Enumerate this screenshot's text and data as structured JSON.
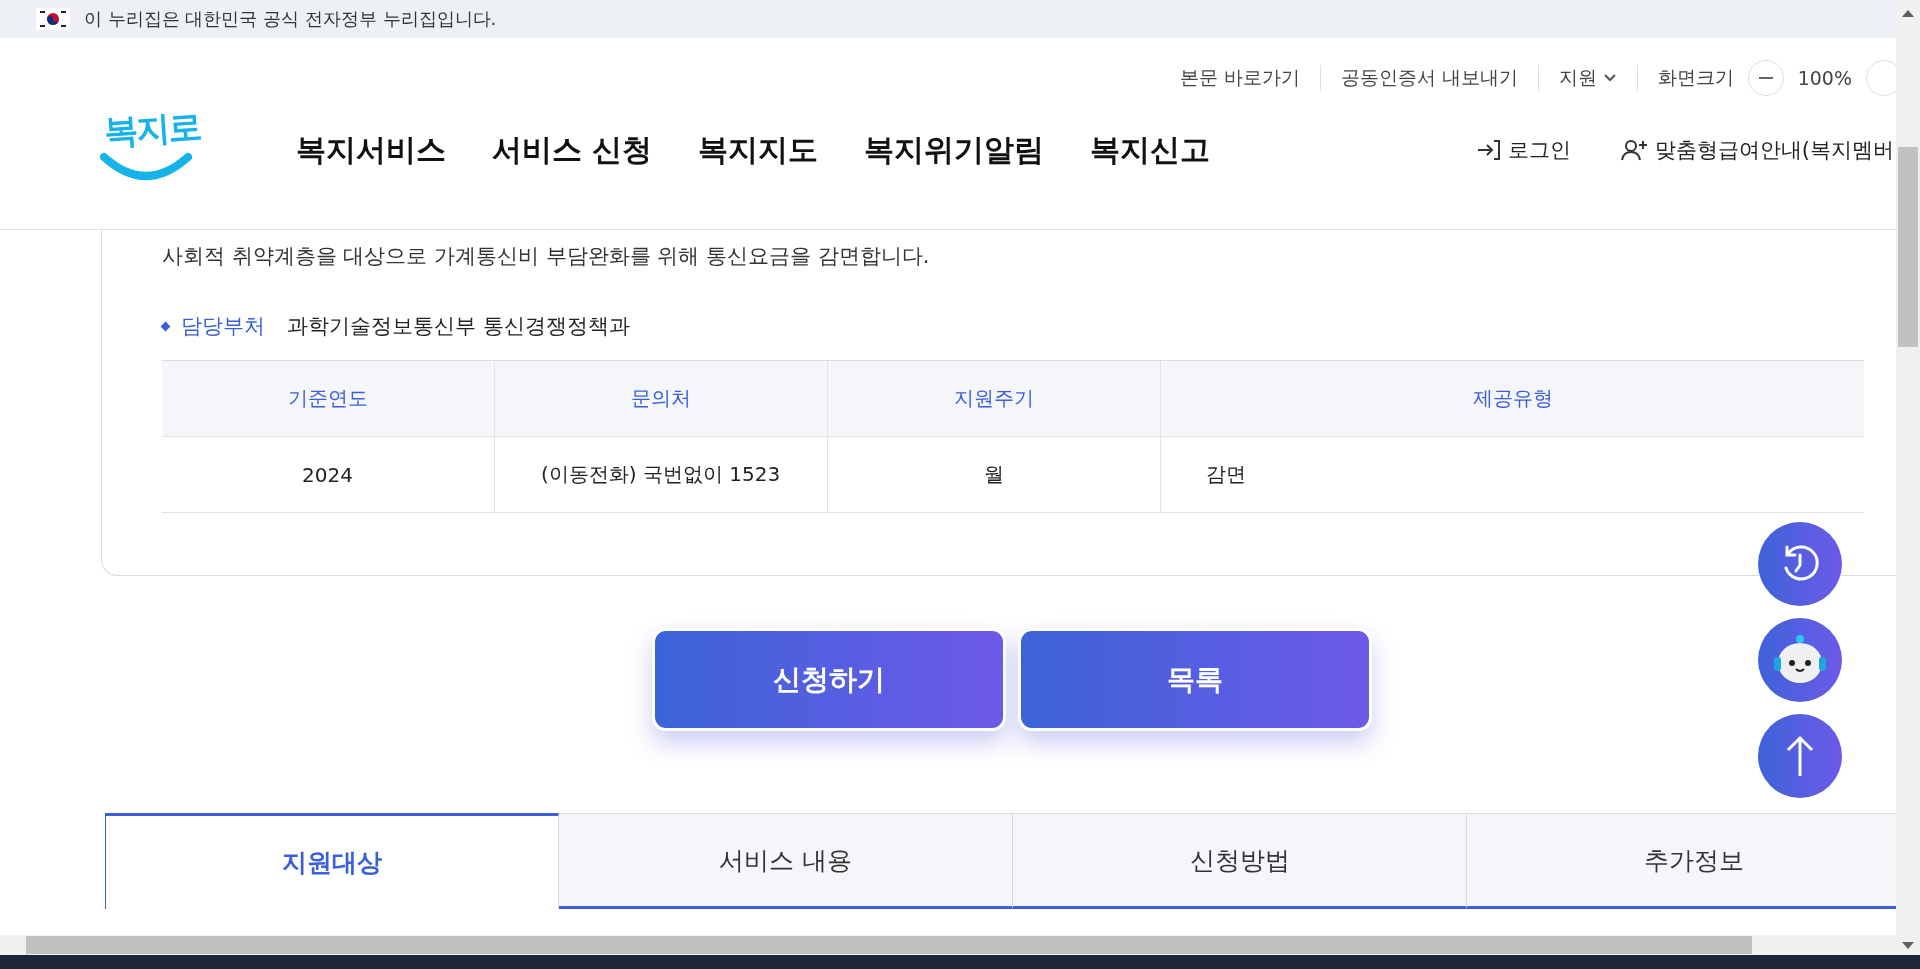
{
  "gov_banner": {
    "text": "이 누리집은 대한민국 공식 전자정부 누리집입니다."
  },
  "utility_links": [
    "본문 바로가기",
    "공동인증서 내보내기",
    "지원"
  ],
  "zoom": {
    "label": "화면크기",
    "reading": "100%"
  },
  "logo": {
    "text": "복지로"
  },
  "nav": [
    "복지서비스",
    "서비스 신청",
    "복지지도",
    "복지위기알림",
    "복지신고"
  ],
  "user_links": [
    {
      "kind": "login",
      "label": "로그인"
    },
    {
      "kind": "member",
      "label": "맞춤형급여안내(복지멤버"
    }
  ],
  "description": "사회적 취약계층을 대상으로 가계통신비 부담완화를 위해 통신요금을 감면합니다.",
  "department": {
    "label": "담당부처",
    "value": "과학기술정보통신부 통신경쟁정책과"
  },
  "table": {
    "columns": [
      "기준연도",
      "문의처",
      "지원주기",
      "제공유형"
    ],
    "rows": [
      [
        "2024",
        "(이동전화) 국번없이 1523",
        "월",
        "감면"
      ]
    ]
  },
  "buttons": [
    "신청하기",
    "목록"
  ],
  "tabs": [
    {
      "label": "지원대상",
      "selected": true
    },
    {
      "label": "서비스 내용",
      "selected": false
    },
    {
      "label": "신청방법",
      "selected": false
    },
    {
      "label": "추가정보",
      "selected": false
    }
  ]
}
